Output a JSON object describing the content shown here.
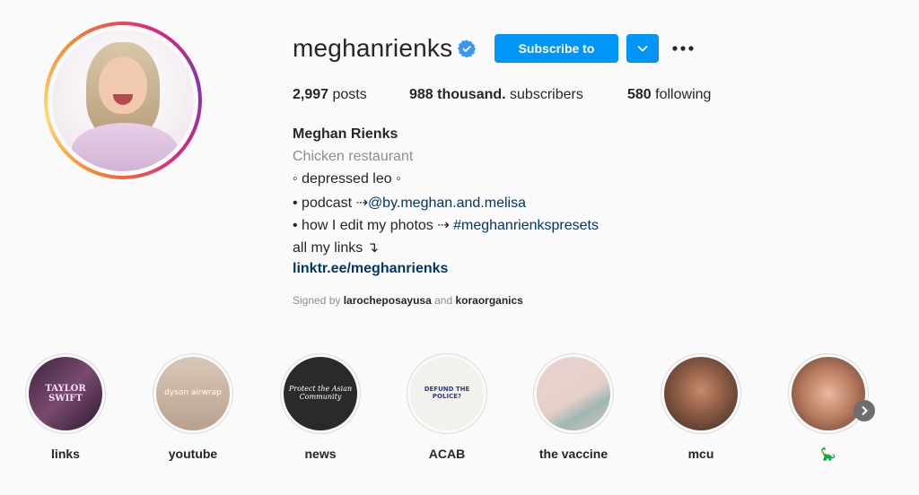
{
  "profile": {
    "username": "meghanrienks",
    "verified": true,
    "subscribe_label": "Subscribe to",
    "accent_color": "#0095f6"
  },
  "stats": {
    "posts_count": "2,997",
    "posts_label": "posts",
    "subscribers_count": "988 thousand.",
    "subscribers_label": "subscribers",
    "following_count": "580",
    "following_label": "following"
  },
  "bio": {
    "name": "Meghan Rienks",
    "category": "Chicken restaurant",
    "line1": "◦ depressed leo ◦",
    "line2_prefix": "• podcast ⇢",
    "line2_link": "@by.meghan.and.melisa",
    "line3_prefix": "• how I edit my photos ⇢ ",
    "line3_link": "#meghanrienkspresets",
    "line4": "all my links ↴",
    "website": "linktr.ee/meghanrienks"
  },
  "signed": {
    "prefix": "Signed by",
    "user1": "larocheposayusa",
    "conjunction": "and",
    "user2": "koraorganics"
  },
  "highlights": [
    {
      "label": "links",
      "cover_text": "TAYLOR SWIFT"
    },
    {
      "label": "youtube",
      "cover_text": "dyson airwrap"
    },
    {
      "label": "news",
      "cover_text": "Protect the Asian Community"
    },
    {
      "label": "ACAB",
      "cover_text": "DEFUND THE POLICE?"
    },
    {
      "label": "the vaccine",
      "cover_text": ""
    },
    {
      "label": "mcu",
      "cover_text": ""
    },
    {
      "label": "🦕",
      "cover_text": ""
    }
  ]
}
